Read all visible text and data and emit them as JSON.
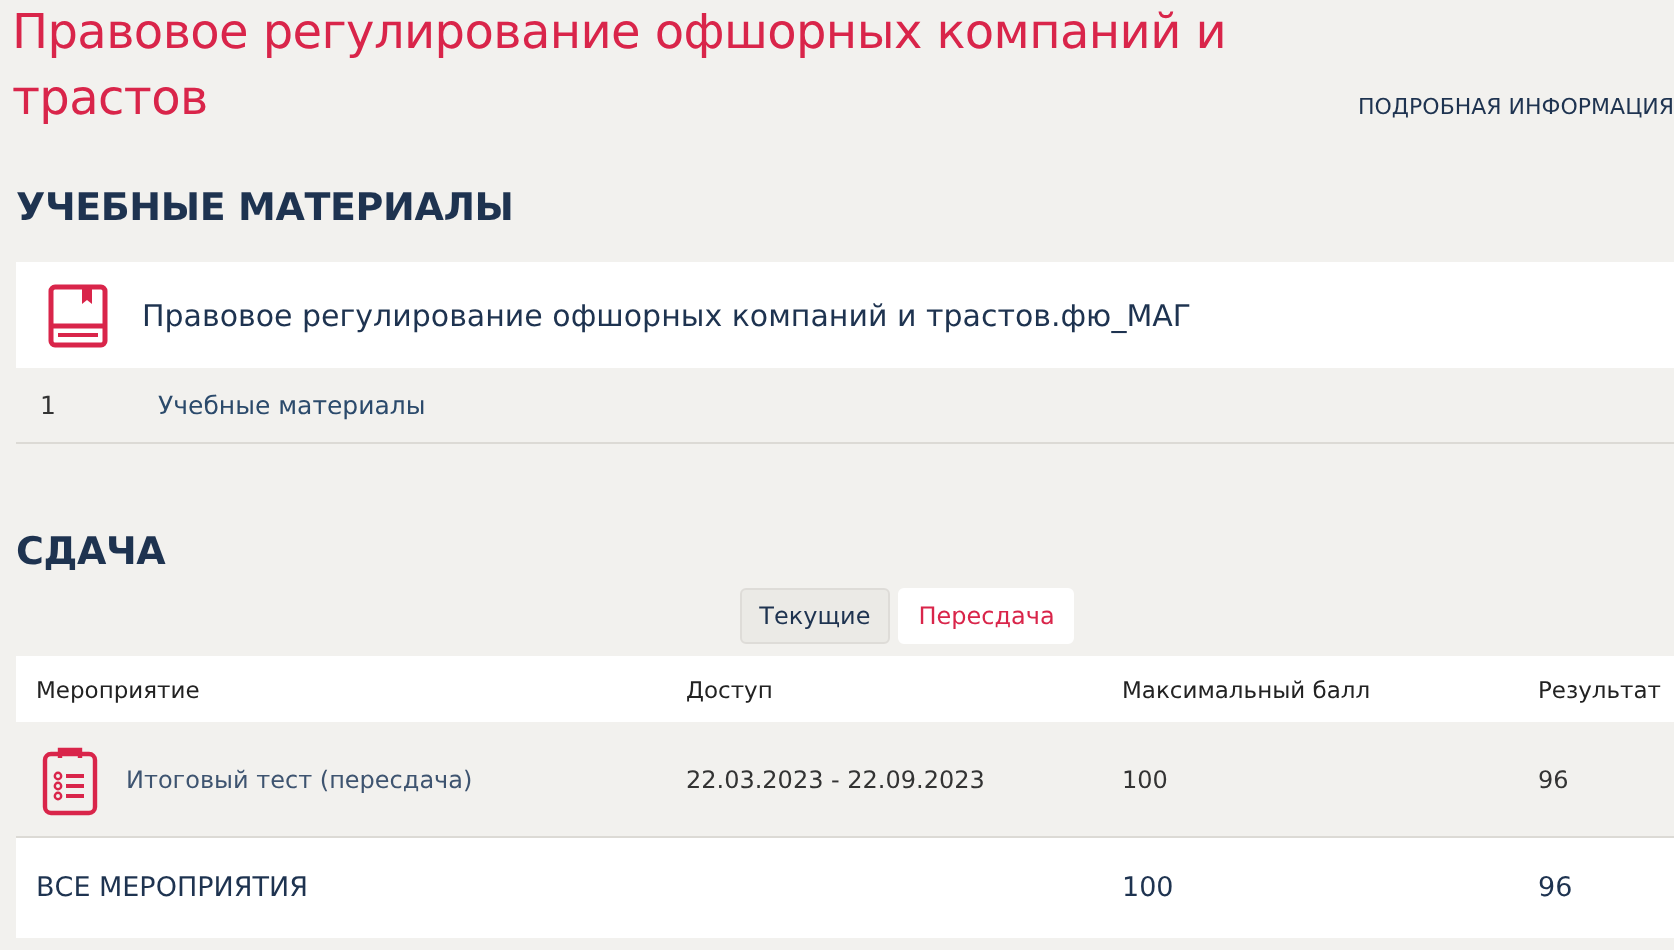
{
  "page_title": "Правовое регулирование офшорных компаний и трастов",
  "details_link": "ПОДРОБНАЯ ИНФОРМАЦИЯ",
  "materials": {
    "heading": "УЧЕБНЫЕ МАТЕРИАЛЫ",
    "course": "Правовое регулирование офшорных компаний и трастов.фю_МАГ",
    "items": [
      {
        "number": "1",
        "label": "Учебные материалы"
      }
    ]
  },
  "exams": {
    "heading": "СДАЧА",
    "tabs": [
      {
        "label": "Текущие",
        "selected": false
      },
      {
        "label": "Пересдача",
        "selected": true
      }
    ],
    "columns": [
      "Мероприятие",
      "Доступ",
      "Максимальный балл",
      "Результат"
    ],
    "rows": [
      {
        "event": "Итоговый тест (пересдача)",
        "access": "22.03.2023 - 22.09.2023",
        "max_score": "100",
        "result": "96"
      }
    ],
    "total": {
      "label": "ВСЕ МЕРОПРИЯТИЯ",
      "max_score": "100",
      "result": "96"
    }
  }
}
